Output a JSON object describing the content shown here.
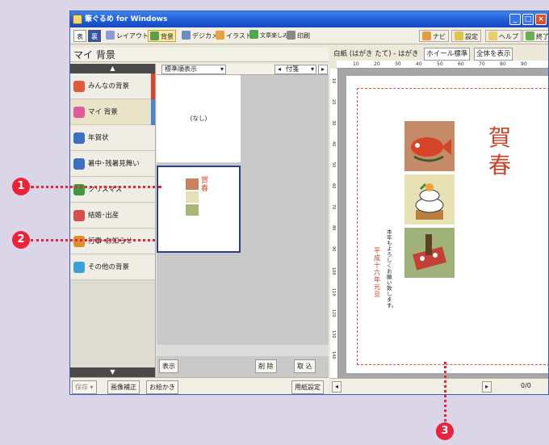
{
  "window": {
    "title": "筆ぐるめ for Windows",
    "buttons": [
      "_",
      "□",
      "×"
    ]
  },
  "toolbar": {
    "left": [
      {
        "label": "表",
        "icon": "omote-tab-icon"
      },
      {
        "label": "裏",
        "icon": "ura-tab-icon"
      },
      {
        "label": "レイアウト",
        "icon": "layout-icon"
      },
      {
        "label": "背景",
        "icon": "background-icon"
      },
      {
        "label": "デジカメ",
        "icon": "camera-icon"
      },
      {
        "label": "イラスト",
        "icon": "illust-icon"
      },
      {
        "label": "文章楽しみ",
        "icon": "text-icon"
      },
      {
        "label": "印刷",
        "icon": "print-icon"
      }
    ],
    "right": [
      {
        "label": "ナビ",
        "icon": "navi-icon"
      },
      {
        "label": "設定",
        "icon": "settings-icon"
      },
      {
        "label": "ヘルプ",
        "icon": "help-icon"
      },
      {
        "label": "終了",
        "icon": "exit-icon"
      }
    ]
  },
  "left": {
    "heading": "マイ 背景",
    "categories": [
      {
        "label": "みんなの背景",
        "color": "#e05b3b",
        "tab": "#d6452a"
      },
      {
        "label": "マイ 背景",
        "color": "#e05b9a",
        "tab": "#4a86cf"
      },
      {
        "label": "年賀状",
        "color": "#3b6fc0",
        "tab": ""
      },
      {
        "label": "暑中･残暑見舞い",
        "color": "#3b6fc0",
        "tab": ""
      },
      {
        "label": "クリスマス",
        "color": "#3c9a3c",
        "tab": ""
      },
      {
        "label": "結婚･出産",
        "color": "#d84d4d",
        "tab": ""
      },
      {
        "label": "行事･お知らせ",
        "color": "#e08e2b",
        "tab": ""
      },
      {
        "label": "その他の背景",
        "color": "#3aa0d8",
        "tab": ""
      }
    ],
    "preview_header": {
      "sort": "標準順表示",
      "field": "付箋"
    },
    "thumb_none": "(なし)",
    "show_button": "表示",
    "delete_button": "削 除",
    "import_button": "取 込",
    "bottom": {
      "save": "保存",
      "image_edit": "画像補正",
      "draw": "お絵かき",
      "paper_settings": "用紙設定"
    }
  },
  "right": {
    "heading": "白紙 (はがき たて) - はがき",
    "wheel": "ホイール標準",
    "view": "全体を表示",
    "ruler_ticks": [
      "10",
      "20",
      "30",
      "40",
      "50",
      "60",
      "70",
      "80",
      "90"
    ],
    "vruler_ticks": [
      "10",
      "20",
      "30",
      "40",
      "50",
      "60",
      "70",
      "80",
      "90",
      "100",
      "110",
      "120",
      "130",
      "140"
    ],
    "page_counter": "0/0",
    "greeting_big": "賀春",
    "message": "本年もよろしくお願い致します。",
    "date": "平成十六年元旦"
  },
  "callouts": [
    "1",
    "2",
    "3"
  ]
}
